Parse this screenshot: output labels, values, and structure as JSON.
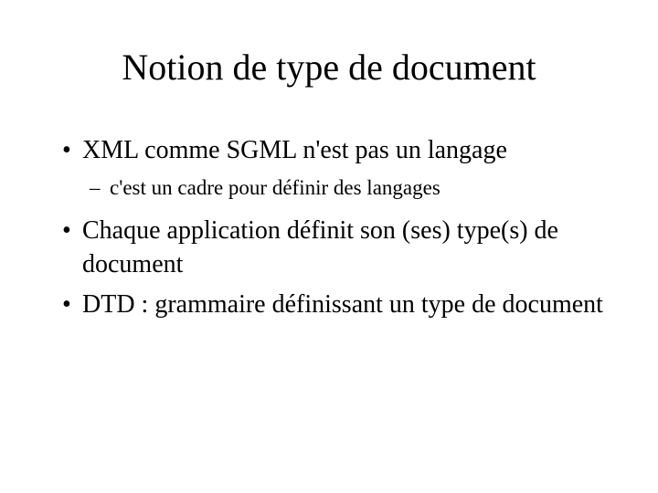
{
  "title": "Notion de type de document",
  "bullets": {
    "b1": "XML comme SGML n'est pas un langage",
    "b1_sub1": "c'est un cadre pour définir des langages",
    "b2": "Chaque application définit son (ses) type(s) de document",
    "b3": "DTD : grammaire définissant un type de document"
  }
}
